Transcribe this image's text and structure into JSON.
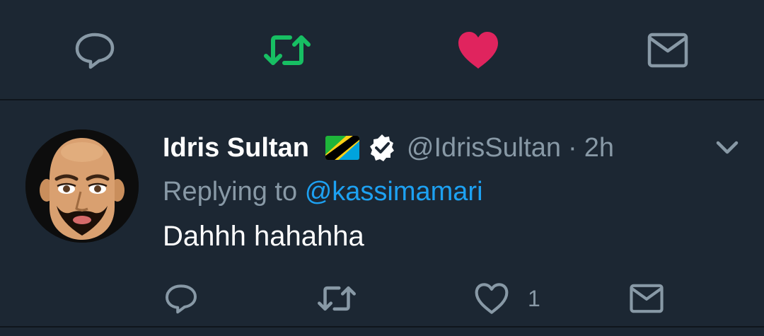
{
  "top_actions": {
    "icons": [
      "reply-icon",
      "retweet-icon",
      "like-icon",
      "dm-icon"
    ],
    "retweeted": true,
    "liked": true,
    "colors": {
      "retweet_active": "#17bf63",
      "like_active": "#e0245e",
      "inactive": "#8899a6"
    }
  },
  "tweet": {
    "author_name": "Idris Sultan",
    "author_handle": "@IdrisSultan",
    "separator": "·",
    "time": "2h",
    "verified": true,
    "flag": "tanzania-flag",
    "replying_prefix": "Replying to",
    "replying_to": "@kassimamari",
    "text": "Dahhh hahahha",
    "actions": {
      "like_count": "1",
      "icons": [
        "reply-icon",
        "retweet-icon",
        "like-icon",
        "dm-icon"
      ]
    }
  },
  "colors": {
    "background": "#1c2733",
    "divider": "#0f151c",
    "text_primary": "#ffffff",
    "text_secondary": "#8899a6",
    "link": "#1da1f2"
  }
}
